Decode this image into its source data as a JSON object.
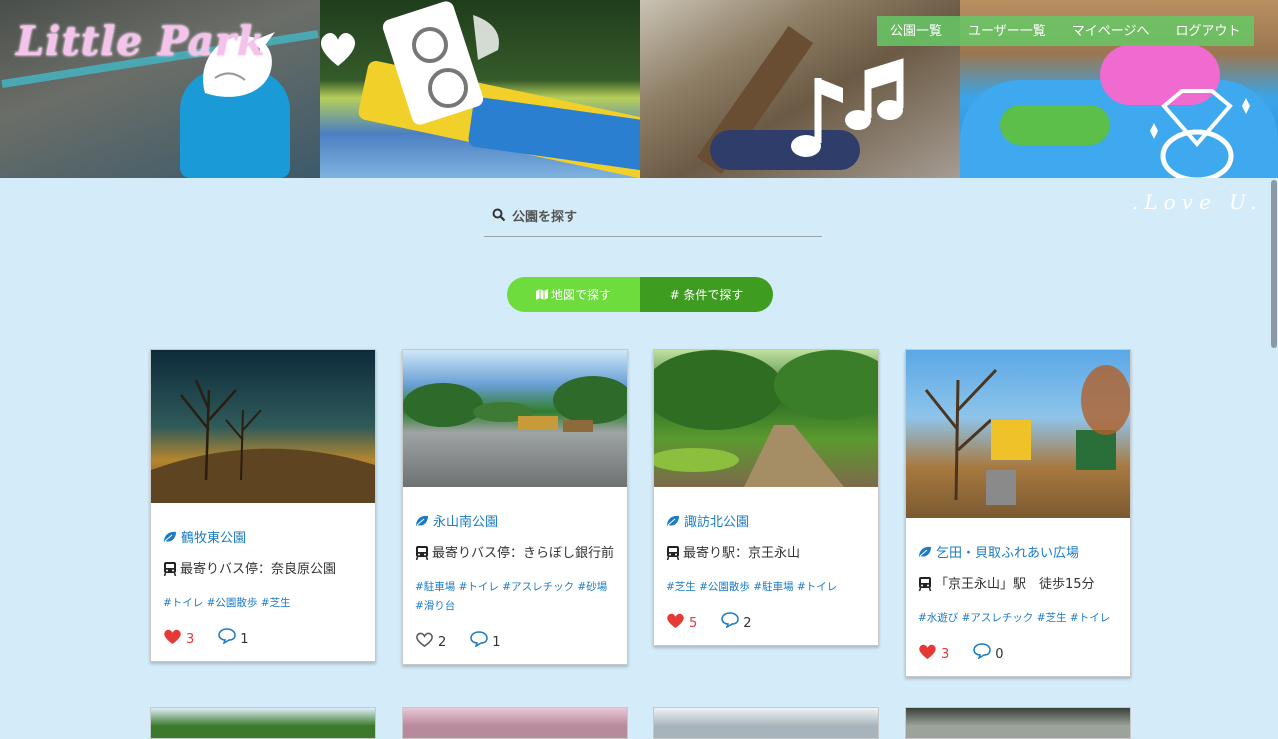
{
  "brand": {
    "logo": "Little Park",
    "love_text": ".Love U."
  },
  "nav": {
    "items": [
      {
        "label": "公園一覧"
      },
      {
        "label": "ユーザー一覧"
      },
      {
        "label": "マイページへ"
      },
      {
        "label": "ログアウト"
      }
    ]
  },
  "search": {
    "placeholder": "公園を探す",
    "icon": "search-icon"
  },
  "toggle": {
    "map_label": "地図で探す",
    "map_icon": "map-icon",
    "condition_label": "# 条件で探す"
  },
  "colors": {
    "background": "#d4ecf9",
    "link": "#1a7bc6",
    "like": "#e53935",
    "toggle_left": "#6ddc3c",
    "toggle_right": "#3e9c21"
  },
  "parks": [
    {
      "name": "鶴牧東公園",
      "access": "最寄りバス停：奈良原公園",
      "tags": "#トイレ #公園散歩 #芝生",
      "likes": "3",
      "liked": true,
      "comments": "1"
    },
    {
      "name": "永山南公園",
      "access": "最寄りバス停：きらぼし銀行前",
      "tags": "#駐車場 #トイレ #アスレチック #砂場 #滑り台",
      "likes": "2",
      "liked": false,
      "comments": "1"
    },
    {
      "name": "諏訪北公園",
      "access": "最寄り駅：京王永山",
      "tags": "#芝生 #公園散歩 #駐車場 #トイレ",
      "likes": "5",
      "liked": true,
      "comments": "2"
    },
    {
      "name": "乞田・貝取ふれあい広場",
      "access": "「京王永山」駅　徒歩15分",
      "tags": "#水遊び #アスレチック #芝生 #トイレ",
      "likes": "3",
      "liked": true,
      "comments": "0"
    }
  ]
}
